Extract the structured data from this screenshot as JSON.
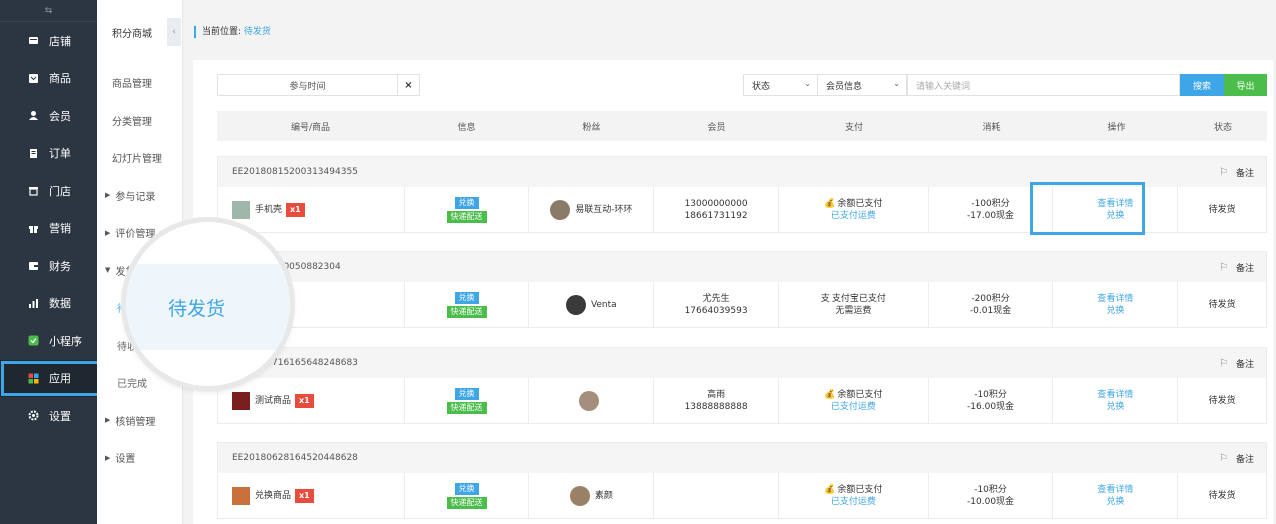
{
  "sidebar": {
    "top_icon": "⇆",
    "items": [
      {
        "label": "店铺",
        "icon": "store-icon"
      },
      {
        "label": "商品",
        "icon": "goods-icon"
      },
      {
        "label": "会员",
        "icon": "user-icon"
      },
      {
        "label": "订单",
        "icon": "order-icon"
      },
      {
        "label": "门店",
        "icon": "shop-icon"
      },
      {
        "label": "营销",
        "icon": "gift-icon"
      },
      {
        "label": "财务",
        "icon": "wallet-icon"
      },
      {
        "label": "数据",
        "icon": "chart-icon"
      },
      {
        "label": "小程序",
        "icon": "miniapp-icon"
      },
      {
        "label": "应用",
        "icon": "apps-icon"
      },
      {
        "label": "设置",
        "icon": "gear-icon"
      }
    ]
  },
  "submenu": {
    "title": "积分商城",
    "collapse_icon": "‹",
    "items": [
      {
        "label": "商品管理",
        "type": "item"
      },
      {
        "label": "分类管理",
        "type": "item"
      },
      {
        "label": "幻灯片管理",
        "type": "item"
      },
      {
        "label": "参与记录",
        "type": "group"
      },
      {
        "label": "评价管理",
        "type": "group"
      },
      {
        "label": "发货管理",
        "type": "group-open"
      },
      {
        "label": "待发货",
        "type": "child-current"
      },
      {
        "label": "待收货",
        "type": "child"
      },
      {
        "label": "已完成",
        "type": "child"
      },
      {
        "label": "核销管理",
        "type": "group"
      },
      {
        "label": "设置",
        "type": "group"
      }
    ]
  },
  "breadcrumb": {
    "prefix": "当前位置:",
    "current": "待发货"
  },
  "filter": {
    "time_label": "参与时间",
    "clear_icon": "×",
    "status_select": "状态",
    "member_select": "会员信息",
    "keyword_placeholder": "请输入关键词",
    "search_label": "搜索",
    "export_label": "导出"
  },
  "table": {
    "headers": [
      "编号/商品",
      "信息",
      "粉丝",
      "会员",
      "支付",
      "消耗",
      "操作",
      "状态"
    ],
    "orders": [
      {
        "id": "EE20180815200313494355",
        "goods": "手机壳",
        "qty": "x1",
        "tag1": "兑换",
        "tag2": "快递配送",
        "fan": "易联互动-环环",
        "member1": "13000000000",
        "member2": "18661731192",
        "pay_icon": "💰",
        "pay1": "余额已支付",
        "pay2": "已支付运费",
        "cost1": "-100积分",
        "cost2": "-17.00现金",
        "op1": "查看详情",
        "op2": "兑换",
        "status": "待发货",
        "remark": "备注",
        "thumb_color": "#9fb7a9",
        "avatar_color": "#8a7a68"
      },
      {
        "id": "EE20181110050882304",
        "goods": "",
        "qty": "x1",
        "tag1": "兑换",
        "tag2": "快递配送",
        "fan": "Venta",
        "member1": "尤先生",
        "member2": "17664039593",
        "pay_icon": "支",
        "pay1": "支付宝已支付",
        "pay2": "无需运费",
        "cost1": "-200积分",
        "cost2": "-0.01现金",
        "op1": "查看详情",
        "op2": "兑换",
        "status": "待发货",
        "remark": "备注",
        "thumb_color": "#c0c0c0",
        "avatar_color": "#3a3a3a"
      },
      {
        "id": "EE20180716165648248683",
        "goods": "测试商品",
        "qty": "x1",
        "tag1": "兑换",
        "tag2": "快递配送",
        "fan": "",
        "member1": "高雨",
        "member2": "13888888888",
        "pay_icon": "💰",
        "pay1": "余额已支付",
        "pay2": "已支付运费",
        "cost1": "-10积分",
        "cost2": "-16.00现金",
        "op1": "查看详情",
        "op2": "兑换",
        "status": "待发货",
        "remark": "备注",
        "thumb_color": "#7a1f1f",
        "avatar_color": "#a58f7c"
      },
      {
        "id": "EE20180628164520448628",
        "goods": "兑换商品",
        "qty": "x1",
        "tag1": "兑换",
        "tag2": "快递配送",
        "fan": "素颜",
        "member1": "",
        "member2": "",
        "pay_icon": "💰",
        "pay1": "余额已支付",
        "pay2": "已支付运费",
        "cost1": "-10积分",
        "cost2": "-10.00现金",
        "op1": "查看详情",
        "op2": "兑换",
        "status": "待发货",
        "remark": "备注",
        "thumb_color": "#c9703d",
        "avatar_color": "#9a8064"
      }
    ]
  },
  "magnifier": {
    "text": "待发货"
  },
  "colors": {
    "accent": "#3ea6e6",
    "green": "#4bbd4a",
    "red": "#e74c3c",
    "sidebar": "#2c3542"
  }
}
